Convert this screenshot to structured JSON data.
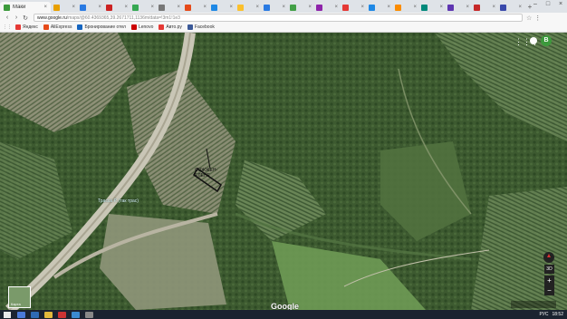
{
  "browser": {
    "active_tab_title": "Маки",
    "url": "www.google.ru/maps/@60.4369365,39.2671711,1136m/data=!3m1!1e3",
    "url_host": "www.google.ru",
    "url_path": "/maps/@60.4369365,39.2671711,1136m/data=!3m1!1e3"
  },
  "tabs": [
    {
      "color": "#e8a000"
    },
    {
      "color": "#2a7ae2"
    },
    {
      "color": "#cc2222"
    },
    {
      "color": "#36a852"
    },
    {
      "color": "#777777"
    },
    {
      "color": "#e64a19"
    },
    {
      "color": "#1e88e5"
    },
    {
      "color": "#fbc02d"
    },
    {
      "color": "#2a7ae2"
    },
    {
      "color": "#43a047"
    },
    {
      "color": "#8e24aa"
    },
    {
      "color": "#e53935"
    },
    {
      "color": "#1e88e5"
    },
    {
      "color": "#fb8c00"
    },
    {
      "color": "#00897b"
    },
    {
      "color": "#5e35b1"
    },
    {
      "color": "#c62828"
    },
    {
      "color": "#3949ab"
    }
  ],
  "bookmarks": [
    {
      "label": "Яндекс",
      "color": "#e53935"
    },
    {
      "label": "AliExpress",
      "color": "#e64a19"
    },
    {
      "label": "Бронирование отел",
      "color": "#1565c0"
    },
    {
      "label": "Lenovo",
      "color": "#cc0000"
    },
    {
      "label": "Авто.ру",
      "color": "#e53935"
    },
    {
      "label": "Facebook",
      "color": "#3b5998"
    }
  ],
  "map": {
    "annotation_line1": "СОЖЖЕН-",
    "annotation_line2": "ЕЛЕНЕ",
    "road_label": "Трасса Р..(так трас)",
    "google_text": "Google",
    "avatar_letter": "В",
    "btn_3d": "3D",
    "zoom_in": "+",
    "zoom_out": "−",
    "layer_label": "Карта"
  },
  "taskbar": {
    "lang": "РУС",
    "time": "18:52"
  }
}
